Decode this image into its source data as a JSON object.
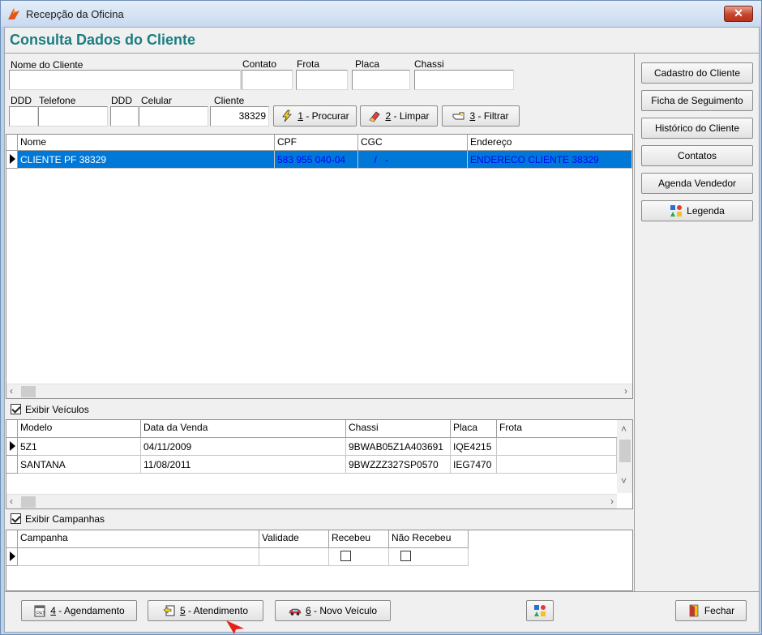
{
  "window": {
    "title": "Recepção da Oficina",
    "close_label": "✕"
  },
  "page_title": "Consulta Dados do Cliente",
  "filters": {
    "nome_cliente_label": "Nome do Cliente",
    "nome_cliente_value": "",
    "contato_label": "Contato",
    "contato_value": "",
    "frota_label": "Frota",
    "frota_value": "",
    "placa_label": "Placa",
    "placa_value": "",
    "chassi_label": "Chassi",
    "chassi_value": "",
    "ddd_label": "DDD",
    "telefone_label": "Telefone",
    "ddd2_label": "DDD",
    "celular_label": "Celular",
    "cliente_label": "Cliente",
    "cliente_value": "38329"
  },
  "search_buttons": {
    "procurar_num": "1",
    "procurar_label": " - Procurar",
    "limpar_num": "2",
    "limpar_label": " - Limpar",
    "filtrar_num": "3",
    "filtrar_label": " - Filtrar"
  },
  "clients_grid": {
    "columns": [
      "Nome",
      "CPF",
      "CGC",
      "Endereço"
    ],
    "rows": [
      {
        "nome": "CLIENTE PF 38329",
        "cpf": "583 955 040-04",
        "cgc": "     /   -",
        "endereco": "ENDERECO CLIENTE 38329"
      }
    ]
  },
  "vehicles": {
    "toggle_label": "Exibir Veículos",
    "toggle_checked": true,
    "columns": [
      "Modelo",
      "Data da Venda",
      "Chassi",
      "Placa",
      "Frota"
    ],
    "rows": [
      {
        "modelo": "5Z1",
        "data": "04/11/2009",
        "chassi": "9BWAB05Z1A403691",
        "placa": "IQE4215",
        "frota": ""
      },
      {
        "modelo": "SANTANA",
        "data": "11/08/2011",
        "chassi": "9BWZZZ327SP0570",
        "placa": "IEG7470",
        "frota": ""
      }
    ]
  },
  "campaigns": {
    "toggle_label": "Exibir Campanhas",
    "toggle_checked": true,
    "columns": [
      "Campanha",
      "Validade",
      "Recebeu",
      "Não Recebeu"
    ]
  },
  "side_buttons": {
    "cadastro": "Cadastro do Cliente",
    "ficha": "Ficha de Seguimento",
    "historico": "Histórico do Cliente",
    "contatos": "Contatos",
    "agenda": "Agenda Vendedor",
    "legenda": "Legenda"
  },
  "bottom_buttons": {
    "agendamento_num": "4",
    "agendamento_label": " - Agendamento",
    "atendimento_num": "5",
    "atendimento_label": " - Atendimento",
    "novo_veiculo_num": "6",
    "novo_veiculo_label": " - Novo Veículo",
    "fechar_label": "Fechar"
  },
  "colors": {
    "selection": "#0078d7",
    "selection_text_blue": "#0000ff",
    "title_teal": "#1a7d80"
  }
}
